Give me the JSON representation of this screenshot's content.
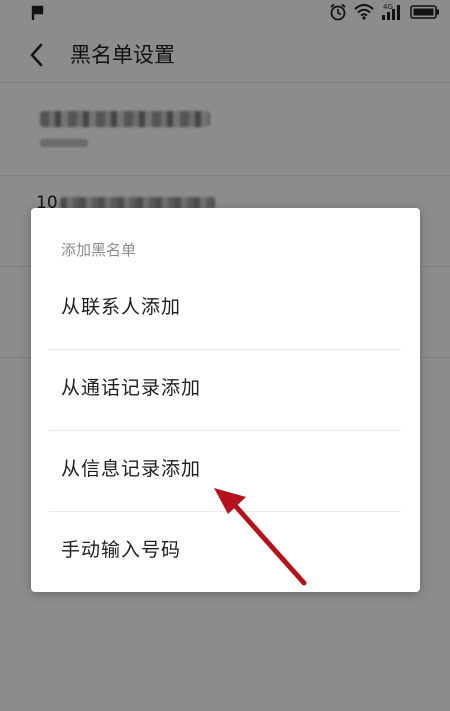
{
  "status_bar": {
    "network_label": "4G",
    "icons": [
      "p-notification-icon",
      "alarm-icon",
      "wifi-icon",
      "signal-icon",
      "battery-icon"
    ]
  },
  "header": {
    "title": "黑名单设置",
    "back_icon": "chevron-left-icon"
  },
  "list": {
    "rows": [
      {
        "primary": "",
        "secondary": ""
      },
      {
        "primary_prefix": "10"
      },
      {
        "primary": ""
      }
    ]
  },
  "dialog": {
    "title": "添加黑名单",
    "options": [
      {
        "label": "从联系人添加"
      },
      {
        "label": "从通话记录添加"
      },
      {
        "label": "从信息记录添加"
      },
      {
        "label": "手动输入号码"
      }
    ]
  },
  "colors": {
    "annotation_arrow": "#b5121b",
    "scrim": "rgba(0,0,0,0.45)",
    "dialog_bg": "#ffffff"
  }
}
